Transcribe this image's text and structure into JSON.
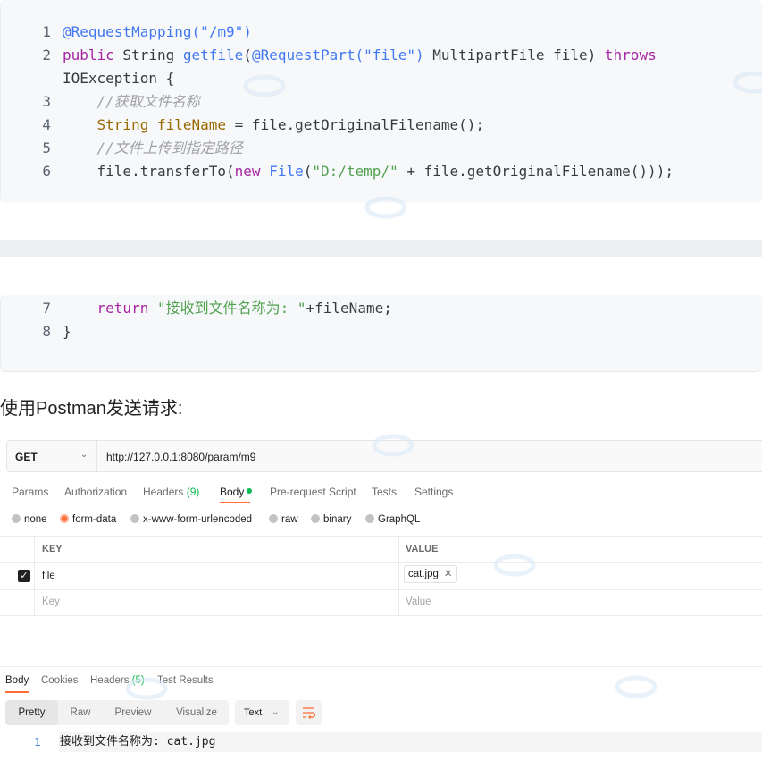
{
  "code_block_1": {
    "lines": [
      {
        "n": "1",
        "parts": [
          {
            "t": "@RequestMapping(",
            "c": "fn"
          },
          {
            "t": "\"/m9\"",
            "c": "fn"
          },
          {
            "t": ")",
            "c": "fn"
          }
        ]
      },
      {
        "n": "2",
        "parts": [
          {
            "t": "public",
            "c": "kw"
          },
          {
            "t": " String ",
            "c": ""
          },
          {
            "t": "getfile",
            "c": "fn"
          },
          {
            "t": "(",
            "c": ""
          },
          {
            "t": "@RequestPart(",
            "c": "fn"
          },
          {
            "t": "\"file\"",
            "c": "fn"
          },
          {
            "t": ")",
            "c": "fn"
          },
          {
            "t": " MultipartFile file) ",
            "c": ""
          },
          {
            "t": "throws",
            "c": "kw"
          }
        ]
      },
      {
        "n": "",
        "parts": [
          {
            "t": "IOException {",
            "c": ""
          }
        ]
      },
      {
        "n": "3",
        "parts": [
          {
            "t": "    //获取文件名称",
            "c": "cm"
          }
        ]
      },
      {
        "n": "4",
        "parts": [
          {
            "t": "    ",
            "c": ""
          },
          {
            "t": "String",
            "c": "type"
          },
          {
            "t": " ",
            "c": ""
          },
          {
            "t": "fileName",
            "c": "type"
          },
          {
            "t": " = file.getOriginalFilename();",
            "c": ""
          }
        ]
      },
      {
        "n": "5",
        "parts": [
          {
            "t": "    //文件上传到指定路径",
            "c": "cm"
          }
        ]
      },
      {
        "n": "6",
        "parts": [
          {
            "t": "    file.transferTo(",
            "c": ""
          },
          {
            "t": "new",
            "c": "kw"
          },
          {
            "t": " ",
            "c": ""
          },
          {
            "t": "File",
            "c": "fn"
          },
          {
            "t": "(",
            "c": ""
          },
          {
            "t": "\"D:/temp/\"",
            "c": "str"
          },
          {
            "t": " + file.getOriginalFilename()));",
            "c": ""
          }
        ]
      }
    ]
  },
  "code_block_2": {
    "lines": [
      {
        "n": "7",
        "parts": [
          {
            "t": "    ",
            "c": ""
          },
          {
            "t": "return",
            "c": "kw"
          },
          {
            "t": " ",
            "c": ""
          },
          {
            "t": "\"接收到文件名称为: \"",
            "c": "str"
          },
          {
            "t": "+fileName;",
            "c": ""
          }
        ]
      },
      {
        "n": "8",
        "parts": [
          {
            "t": "}",
            "c": ""
          }
        ]
      }
    ]
  },
  "heading": "使用Postman发送请求:",
  "postman": {
    "method": "GET",
    "url": "http://127.0.0.1:8080/param/m9",
    "tabs": [
      {
        "label": "Params",
        "count": ""
      },
      {
        "label": "Authorization",
        "count": ""
      },
      {
        "label": "Headers",
        "count": "(9)"
      },
      {
        "label": "Body",
        "count": ""
      },
      {
        "label": "Pre-request Script",
        "count": ""
      },
      {
        "label": "Tests",
        "count": ""
      },
      {
        "label": "Settings",
        "count": ""
      }
    ],
    "body_types": [
      "none",
      "form-data",
      "x-www-form-urlencoded",
      "raw",
      "binary",
      "GraphQL"
    ],
    "selected_body_type": "form-data",
    "kv_headers": {
      "key": "KEY",
      "value": "VALUE"
    },
    "rows": [
      {
        "key": "file",
        "value": "cat.jpg",
        "checked": true
      }
    ],
    "placeholders": {
      "key": "Key",
      "value": "Value"
    },
    "response_tabs": [
      {
        "label": "Body",
        "count": ""
      },
      {
        "label": "Cookies",
        "count": ""
      },
      {
        "label": "Headers",
        "count": "(5)"
      },
      {
        "label": "Test Results",
        "count": ""
      }
    ],
    "view_modes": [
      "Pretty",
      "Raw",
      "Preview",
      "Visualize"
    ],
    "active_view": "Pretty",
    "format": "Text",
    "response_line_number": "1",
    "response_text": "接收到文件名称为: cat.jpg"
  },
  "colors": {
    "accent": "#ff6c37",
    "count_green": "#0cbb52"
  }
}
